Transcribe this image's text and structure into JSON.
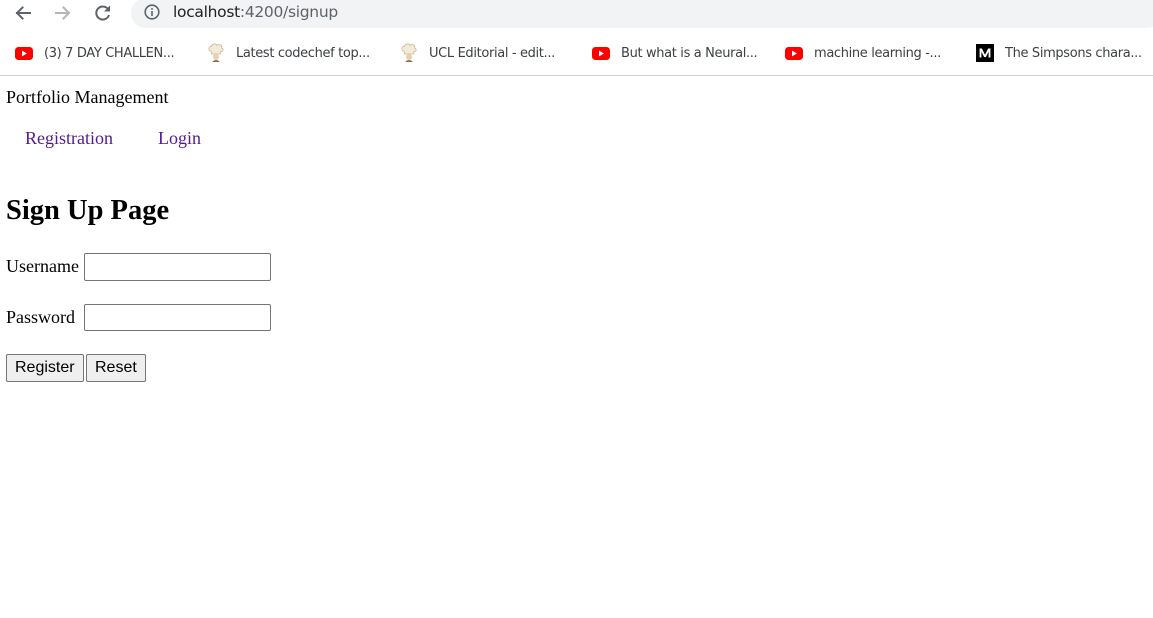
{
  "browser": {
    "url_host": "localhost",
    "url_path": ":4200/signup",
    "nav_icons": [
      "back-arrow-icon",
      "forward-arrow-icon",
      "reload-icon",
      "site-info-icon"
    ],
    "bookmarks": [
      {
        "label": "(3) 7 DAY CHALLEN...",
        "icon": "youtube-icon"
      },
      {
        "label": "Latest codechef top...",
        "icon": "codechef-chef-icon"
      },
      {
        "label": "UCL Editorial - edit...",
        "icon": "codechef-chef-icon"
      },
      {
        "label": "But what is a Neural...",
        "icon": "youtube-icon"
      },
      {
        "label": "machine learning -...",
        "icon": "youtube-icon"
      },
      {
        "label": "The Simpsons chara...",
        "icon": "medium-icon"
      }
    ]
  },
  "page": {
    "brand": "Portfolio Management",
    "nav": {
      "registration": "Registration",
      "login": "Login"
    },
    "heading": "Sign Up Page",
    "form": {
      "username_label": "Username",
      "username_value": "",
      "password_label": "Password",
      "password_value": "",
      "register_button": "Register",
      "reset_button": "Reset"
    }
  },
  "colors": {
    "link_visited": "#551a8b",
    "youtube_red": "#ff0000",
    "omnibox_bg": "#f1f3f4"
  }
}
